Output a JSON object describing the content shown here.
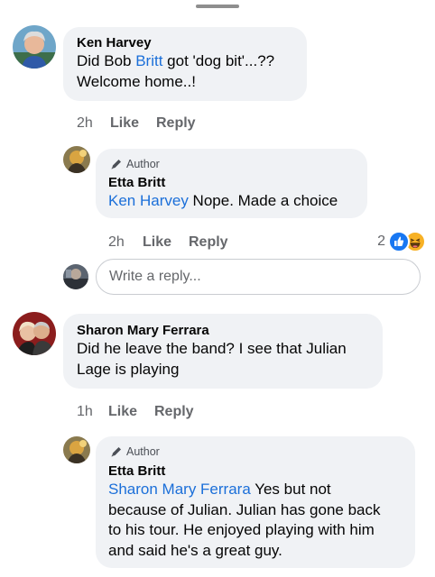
{
  "comments": [
    {
      "name": "Ken Harvey",
      "line1_a": "Did Bob ",
      "line1_mention": "Britt",
      "line1_b": " got 'dog bit'...??",
      "line2": "Welcome home..!",
      "time": "2h",
      "like": "Like",
      "reply": "Reply"
    },
    {
      "author_badge": "Author",
      "name": "Etta Britt",
      "mention": "Ken Harvey",
      "text": " Nope. Made a choice",
      "time": "2h",
      "like": "Like",
      "reply": "Reply",
      "reaction_count": "2",
      "reaction_icons": [
        "like-icon",
        "haha-icon"
      ]
    },
    {
      "name": "Sharon Mary Ferrara",
      "line1": "Did he leave the band?  I see that Julian",
      "line2": "Lage is playing",
      "time": "1h",
      "like": "Like",
      "reply": "Reply"
    },
    {
      "author_badge": "Author",
      "name": "Etta Britt",
      "mention": "Sharon Mary Ferrara",
      "line1_rest": " Yes but not",
      "line2": "because of Julian. Julian has gone back",
      "line3": "to his tour. He enjoyed playing with him",
      "line4": "and said he's a great guy."
    }
  ],
  "reply_input": {
    "placeholder": "Write a reply..."
  },
  "colors": {
    "bubble": "#f0f2f5",
    "mention": "#1b6fd9",
    "meta": "#65676b",
    "like_reaction": "#1877f2",
    "haha_reaction": "#f7b125"
  }
}
